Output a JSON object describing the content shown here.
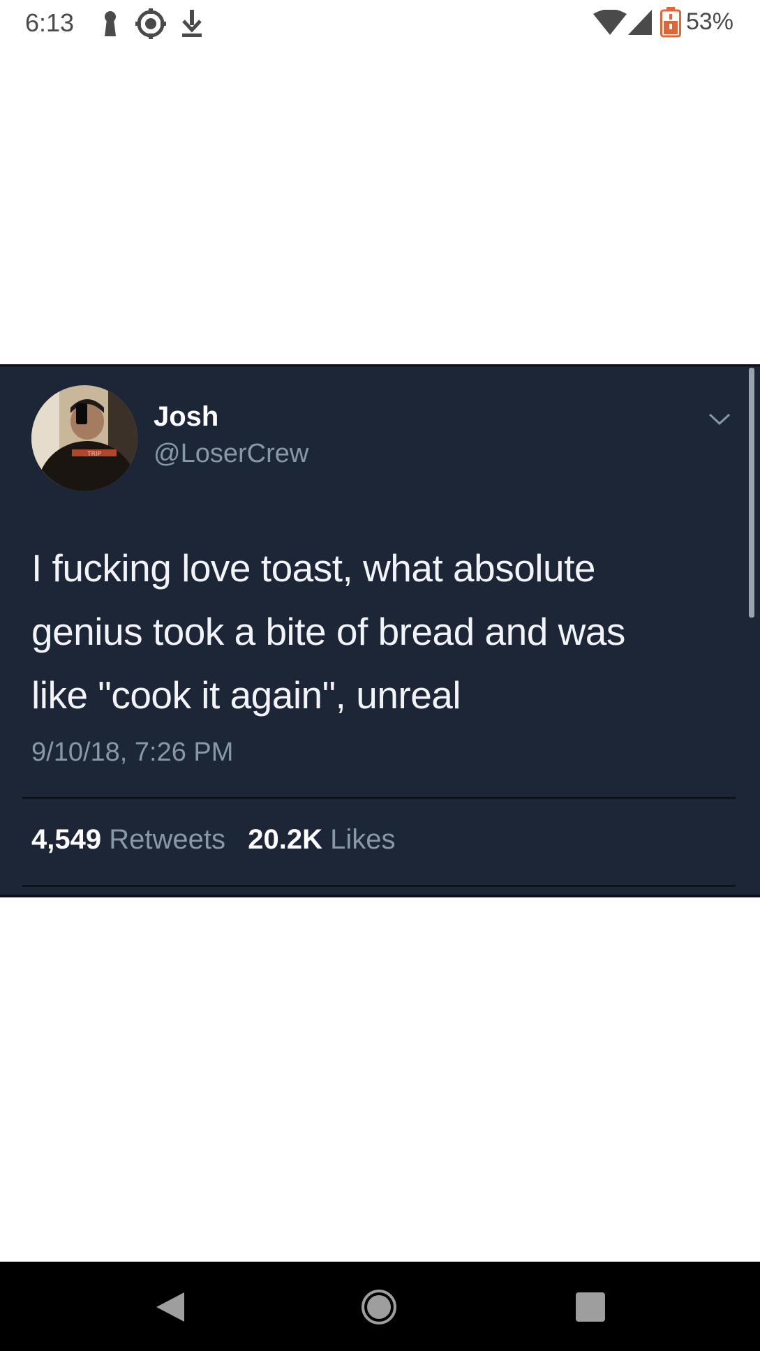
{
  "status_bar": {
    "time": "6:13",
    "battery_percent": "53%",
    "icons": [
      "keyhole-icon",
      "settings-circle-icon",
      "download-icon",
      "wifi-icon",
      "signal-icon",
      "battery-icon"
    ],
    "battery_color": "#e0663a"
  },
  "tweet": {
    "author_name": "Josh",
    "author_handle": "@LoserCrew",
    "text_lines": [
      "I fucking love toast, what absolute",
      "genius took a bite of bread and was",
      "like \"cook it again\", unreal"
    ],
    "timestamp": "9/10/18, 7:26 PM",
    "retweets": {
      "count": "4,549",
      "label": "Retweets"
    },
    "likes": {
      "count": "20.2K",
      "label": "Likes"
    },
    "background_color": "#1d2636"
  },
  "nav_bar": {
    "buttons": [
      "back-icon",
      "home-icon",
      "recents-icon"
    ]
  }
}
